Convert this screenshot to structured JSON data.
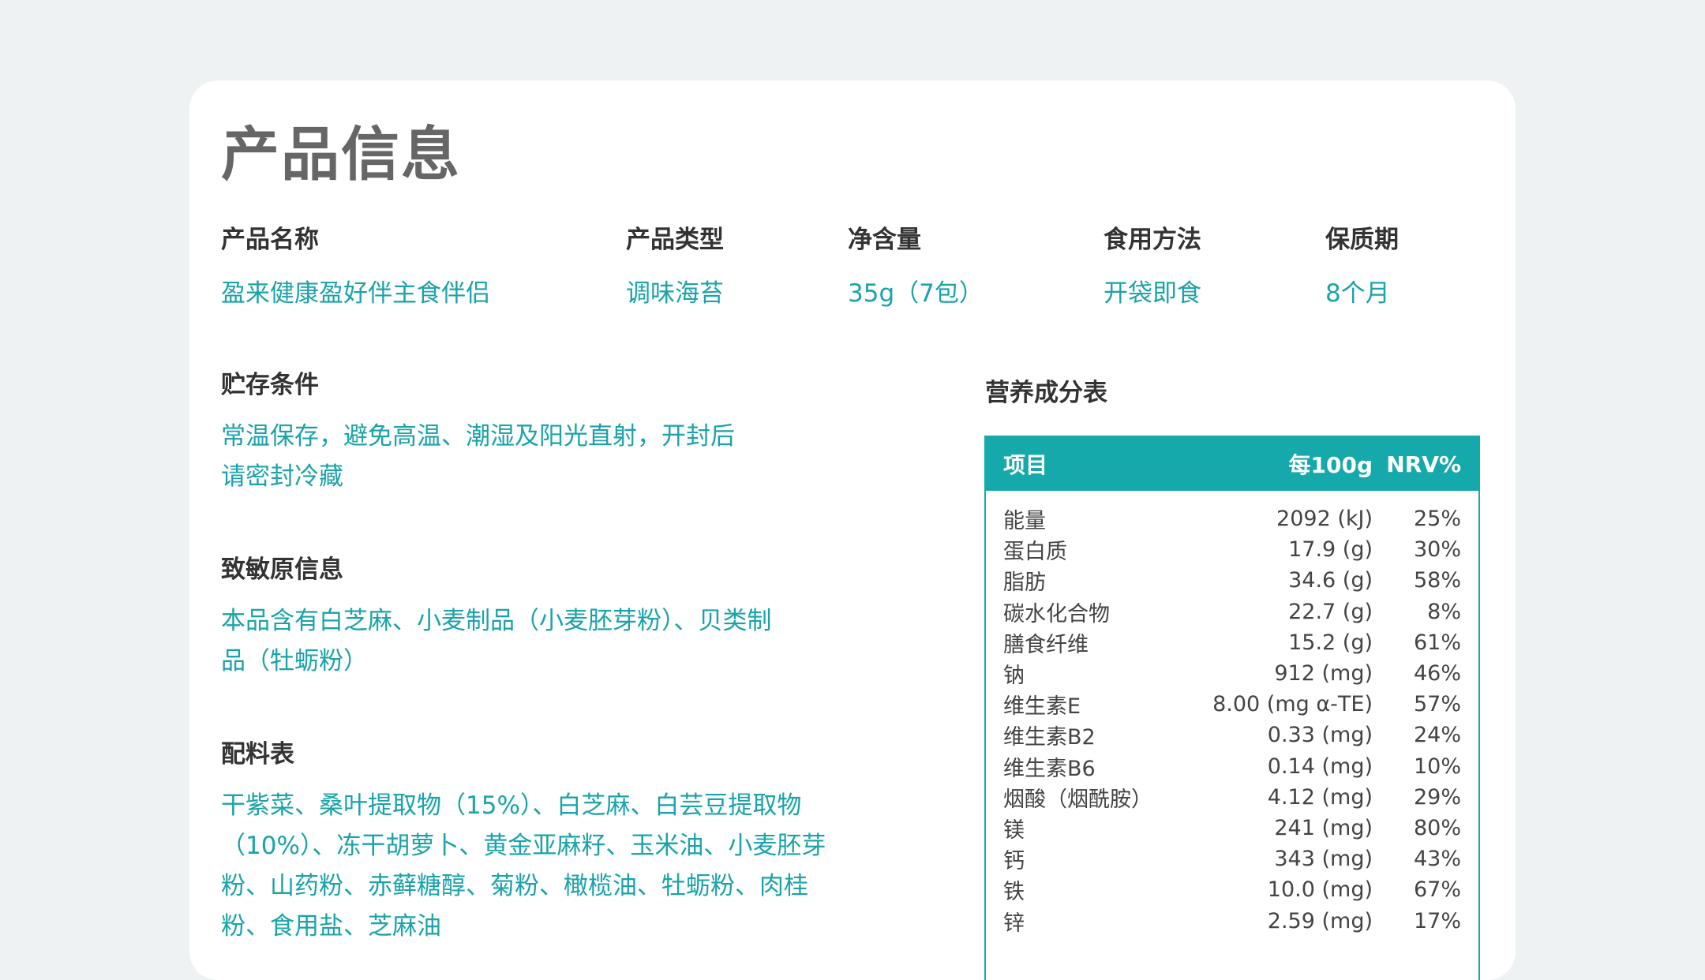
{
  "page_title": "产品信息",
  "info": [
    {
      "label": "产品名称",
      "value": "盈来健康盈好伴主食伴侣"
    },
    {
      "label": "产品类型",
      "value": "调味海苔"
    },
    {
      "label": "净含量",
      "value": "35g（7包）"
    },
    {
      "label": "食用方法",
      "value": "开袋即食"
    },
    {
      "label": "保质期",
      "value": "8个月"
    }
  ],
  "storage": {
    "label": "贮存条件",
    "text": "常温保存，避免高温、潮湿及阳光直射，开封后请密封冷藏"
  },
  "allergen": {
    "label": "致敏原信息",
    "text": "本品含有白芝麻、小麦制品（小麦胚芽粉）、贝类制品（牡蛎粉）"
  },
  "ingredients": {
    "label": "配料表",
    "text": "干紫菜、桑叶提取物（15%）、白芝麻、白芸豆提取物（10%）、冻干胡萝卜、黄金亚麻籽、玉米油、小麦胚芽粉、山药粉、赤藓糖醇、菊粉、橄榄油、牡蛎粉、肉桂粉、食用盐、芝麻油"
  },
  "nutrition": {
    "title": "营养成分表",
    "headers": [
      "项目",
      "每100g",
      "NRV%"
    ],
    "rows": [
      {
        "item": "能量",
        "amount": "2092 (kJ)",
        "nrv": "25%"
      },
      {
        "item": "蛋白质",
        "amount": "17.9 (g)",
        "nrv": "30%"
      },
      {
        "item": "脂肪",
        "amount": "34.6 (g)",
        "nrv": "58%"
      },
      {
        "item": "碳水化合物",
        "amount": "22.7 (g)",
        "nrv": "8%"
      },
      {
        "item": "膳食纤维",
        "amount": "15.2 (g)",
        "nrv": "61%"
      },
      {
        "item": "钠",
        "amount": "912 (mg)",
        "nrv": "46%"
      },
      {
        "item": "维生素E",
        "amount": "8.00 (mg α-TE)",
        "nrv": "57%"
      },
      {
        "item": "维生素B2",
        "amount": "0.33 (mg)",
        "nrv": "24%"
      },
      {
        "item": "维生素B6",
        "amount": "0.14 (mg)",
        "nrv": "10%"
      },
      {
        "item": "烟酸（烟酰胺）",
        "amount": "4.12 (mg)",
        "nrv": "29%"
      },
      {
        "item": "镁",
        "amount": "241 (mg)",
        "nrv": "80%"
      },
      {
        "item": "钙",
        "amount": "343 (mg)",
        "nrv": "43%"
      },
      {
        "item": "铁",
        "amount": "10.0 (mg)",
        "nrv": "67%"
      },
      {
        "item": "锌",
        "amount": "2.59 (mg)",
        "nrv": "17%"
      }
    ]
  },
  "colors": {
    "accent": "#15a9ab",
    "value_text": "#1aa3a8",
    "background": "#eff2f3",
    "card": "#ffffff"
  }
}
